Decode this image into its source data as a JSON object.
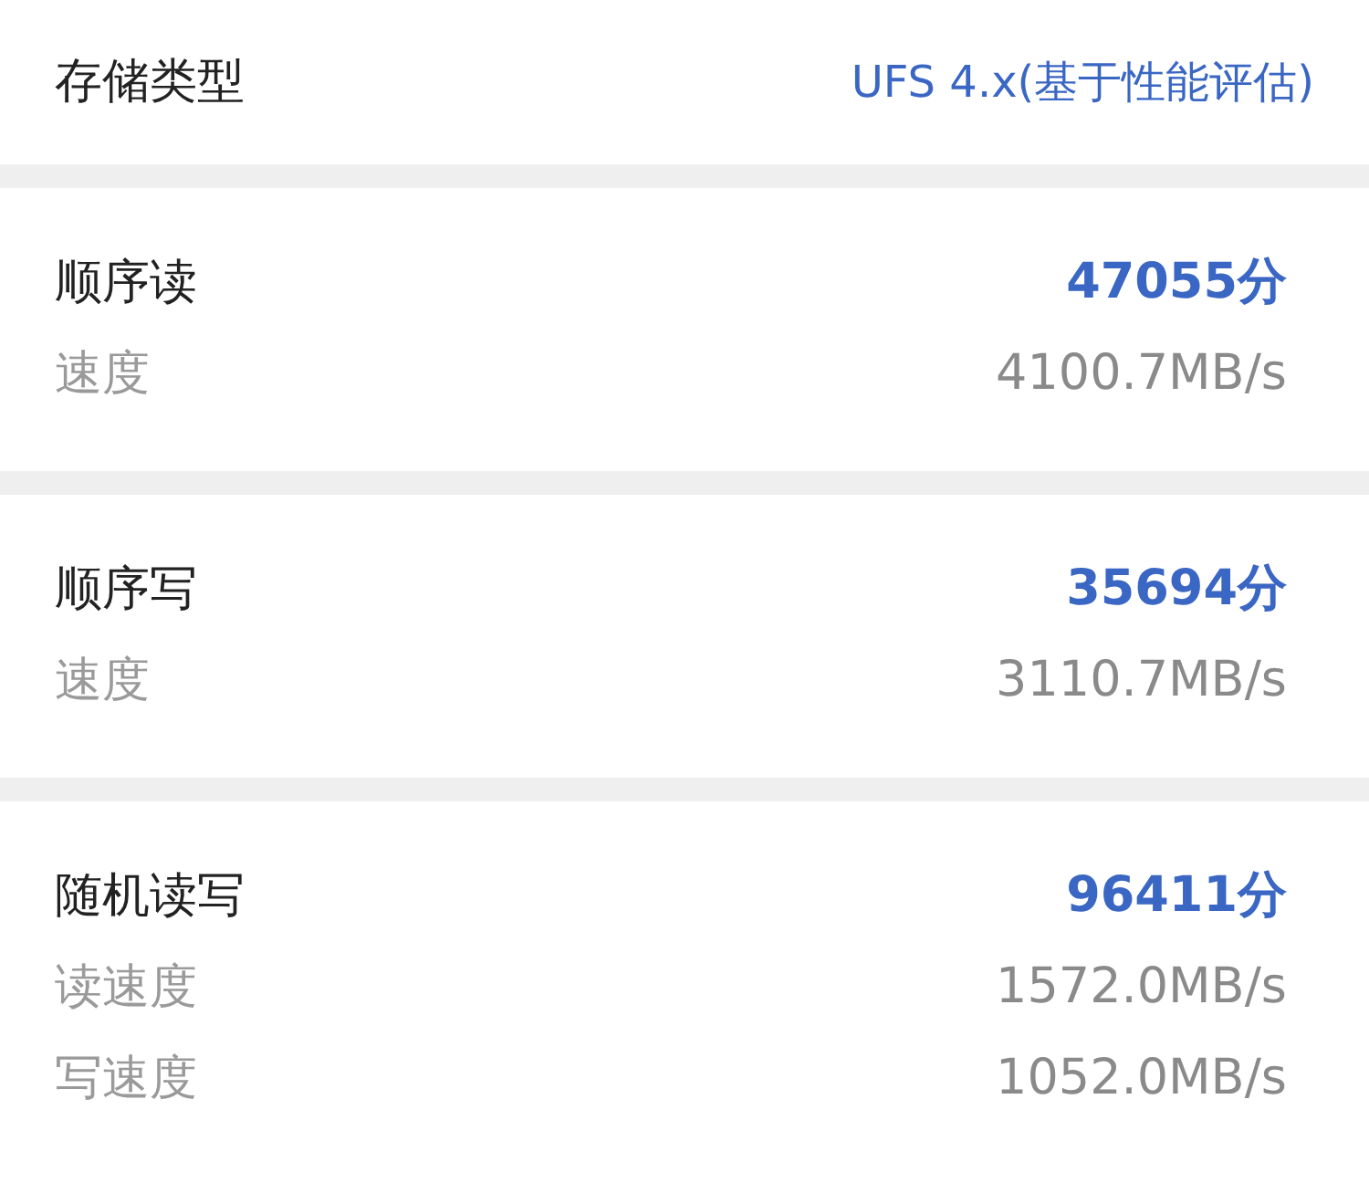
{
  "storage_type": {
    "label": "存储类型",
    "value": "UFS 4.x(基于性能评估)"
  },
  "sections": [
    {
      "title": "顺序读",
      "score": "47055分",
      "metrics": [
        {
          "label": "速度",
          "value": "4100.7MB/s"
        }
      ]
    },
    {
      "title": "顺序写",
      "score": "35694分",
      "metrics": [
        {
          "label": "速度",
          "value": "3110.7MB/s"
        }
      ]
    },
    {
      "title": "随机读写",
      "score": "96411分",
      "metrics": [
        {
          "label": "读速度",
          "value": "1572.0MB/s"
        },
        {
          "label": "写速度",
          "value": "1052.0MB/s"
        }
      ]
    }
  ]
}
